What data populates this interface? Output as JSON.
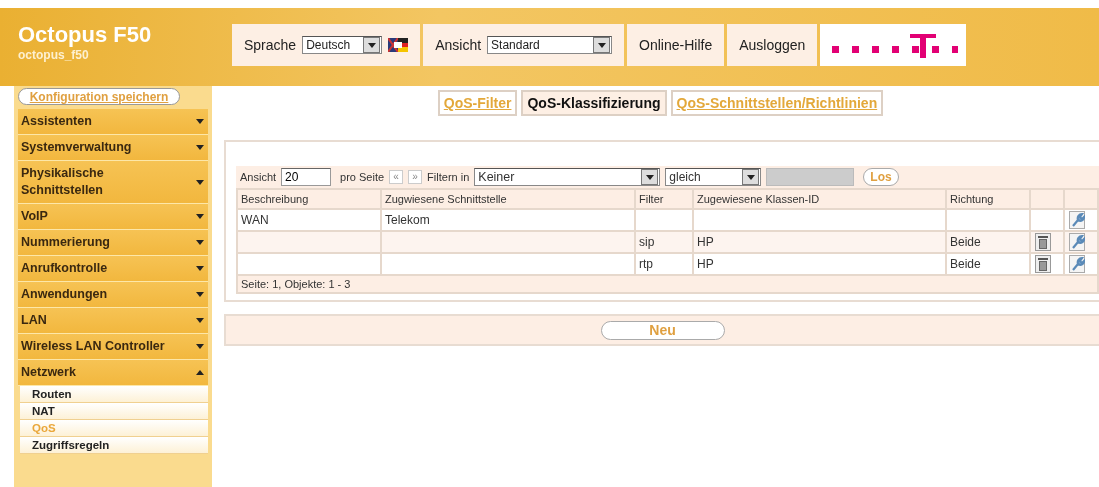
{
  "header": {
    "title": "Octopus F50",
    "subtitle": "octopus_f50",
    "language_label": "Sprache",
    "language": "Deutsch",
    "view_label": "Ansicht",
    "view": "Standard",
    "help": "Online-Hilfe",
    "logout": "Ausloggen"
  },
  "save_button": "Konfiguration speichern",
  "sidebar": {
    "items": [
      {
        "label": "Assistenten",
        "expanded": false
      },
      {
        "label": "Systemverwaltung",
        "expanded": false
      },
      {
        "label": "Physikalische Schnittstellen",
        "expanded": false
      },
      {
        "label": "VoIP",
        "expanded": false
      },
      {
        "label": "Nummerierung",
        "expanded": false
      },
      {
        "label": "Anrufkontrolle",
        "expanded": false
      },
      {
        "label": "Anwendungen",
        "expanded": false
      },
      {
        "label": "LAN",
        "expanded": false
      },
      {
        "label": "Wireless LAN Controller",
        "expanded": false
      },
      {
        "label": "Netzwerk",
        "expanded": true,
        "children": [
          {
            "label": "Routen",
            "selected": false
          },
          {
            "label": "NAT",
            "selected": false
          },
          {
            "label": "QoS",
            "selected": true
          },
          {
            "label": "Zugriffsregeln",
            "selected": false
          }
        ]
      }
    ]
  },
  "tabs": [
    {
      "label": "QoS-Filter",
      "selected": false
    },
    {
      "label": "QoS-Klassifizierung",
      "selected": true
    },
    {
      "label": "QoS-Schnittstellen/Richtlinien",
      "selected": false
    }
  ],
  "list_toolbar": {
    "view_label": "Ansicht",
    "per_page": "20",
    "per_page_label": "pro Seite",
    "prev": "«",
    "next": "»",
    "filter_label": "Filtern in",
    "filter_field": "Keiner",
    "operator": "gleich",
    "go": "Los"
  },
  "table": {
    "columns": [
      "Beschreibung",
      "Zugwiesene Schnittstelle",
      "Filter",
      "Zugewiesene Klassen-ID",
      "Richtung"
    ],
    "rows": [
      {
        "cells": [
          "WAN",
          "Telekom",
          "",
          "",
          ""
        ],
        "deletable": false
      },
      {
        "cells": [
          "",
          "",
          "sip",
          "HP",
          "Beide"
        ],
        "deletable": true
      },
      {
        "cells": [
          "",
          "",
          "rtp",
          "HP",
          "Beide"
        ],
        "deletable": true
      }
    ],
    "footer": "Seite:  1, Objekte:  1 - 3"
  },
  "new_button": "Neu"
}
